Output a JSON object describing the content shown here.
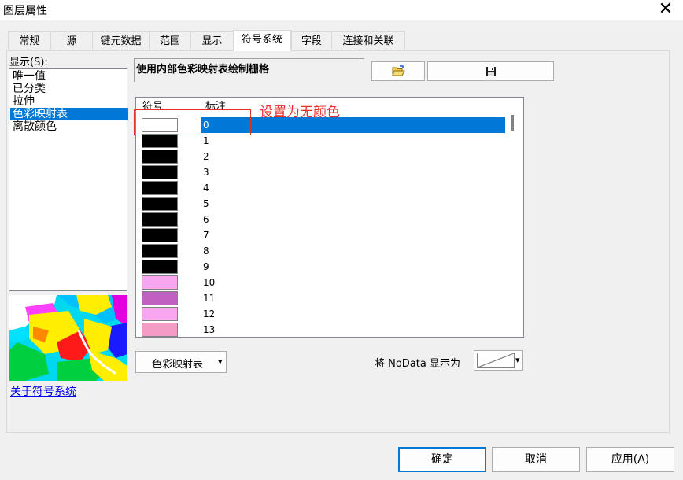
{
  "window": {
    "title": "图层属性",
    "close_glyph": "✕"
  },
  "tabs": [
    {
      "label": "常规"
    },
    {
      "label": "源"
    },
    {
      "label": "键元数据"
    },
    {
      "label": "范围"
    },
    {
      "label": "显示"
    },
    {
      "label": "符号系统",
      "active": true
    },
    {
      "label": "字段"
    },
    {
      "label": "连接和关联"
    }
  ],
  "show_panel": {
    "label": "显示(S):",
    "items": [
      "唯一值",
      "已分类",
      "拉伸",
      "色彩映射表",
      "离散颜色"
    ],
    "selected_index": 3,
    "about_link": "关于符号系统"
  },
  "main": {
    "description": "使用内部色彩映射表绘制栅格",
    "open_icon": "folder-open-icon",
    "save_icon": "save-disk-icon",
    "table": {
      "col_symbol": "符号",
      "col_label": "标注",
      "rows": [
        {
          "label": "0",
          "color": "#ffffff",
          "selected": true
        },
        {
          "label": "1",
          "color": "#000000"
        },
        {
          "label": "2",
          "color": "#000000"
        },
        {
          "label": "3",
          "color": "#000000"
        },
        {
          "label": "4",
          "color": "#000000"
        },
        {
          "label": "5",
          "color": "#000000"
        },
        {
          "label": "6",
          "color": "#000000"
        },
        {
          "label": "7",
          "color": "#000000"
        },
        {
          "label": "8",
          "color": "#000000"
        },
        {
          "label": "9",
          "color": "#000000"
        },
        {
          "label": "10",
          "color": "#f8a6f0"
        },
        {
          "label": "11",
          "color": "#c060c0"
        },
        {
          "label": "12",
          "color": "#f8a6f0"
        },
        {
          "label": "13",
          "color": "#f59cc6"
        }
      ]
    },
    "annotation": "设置为无颜色",
    "colormap_button": "色彩映射表",
    "dropdown_glyph": "▾",
    "nodata_label": "将 NoData 显示为"
  },
  "footer": {
    "ok": "确定",
    "cancel": "取消",
    "apply": "应用(A)"
  },
  "colors": {
    "selection": "#0078d7",
    "annotation": "#e8302a"
  }
}
